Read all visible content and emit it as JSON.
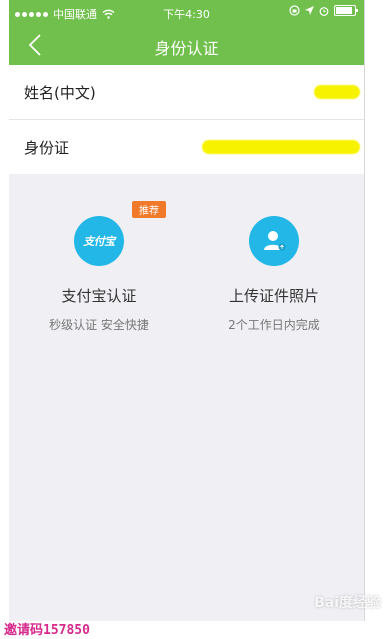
{
  "status_bar": {
    "carrier": "中国联通",
    "time": "下午4:30"
  },
  "navbar": {
    "title": "身份认证",
    "back_icon": "chevron-left-icon"
  },
  "form": {
    "rows": [
      {
        "label": "姓名(中文)"
      },
      {
        "label": "身份证"
      }
    ]
  },
  "options": {
    "alipay": {
      "badge": "推荐",
      "icon_text": "支付宝",
      "title": "支付宝认证",
      "subtitle": "秒级认证 安全快捷"
    },
    "upload": {
      "title": "上传证件照片",
      "subtitle": "2个工作日内完成",
      "icon": "person-upload-icon"
    }
  },
  "colors": {
    "header_green": "#71c04d",
    "icon_blue": "#22b7e6",
    "badge_orange": "#f0792a",
    "redaction_yellow": "#f7f300"
  },
  "watermarks": {
    "invite_code": "邀请码157850",
    "baidu": "Bai度经验"
  }
}
